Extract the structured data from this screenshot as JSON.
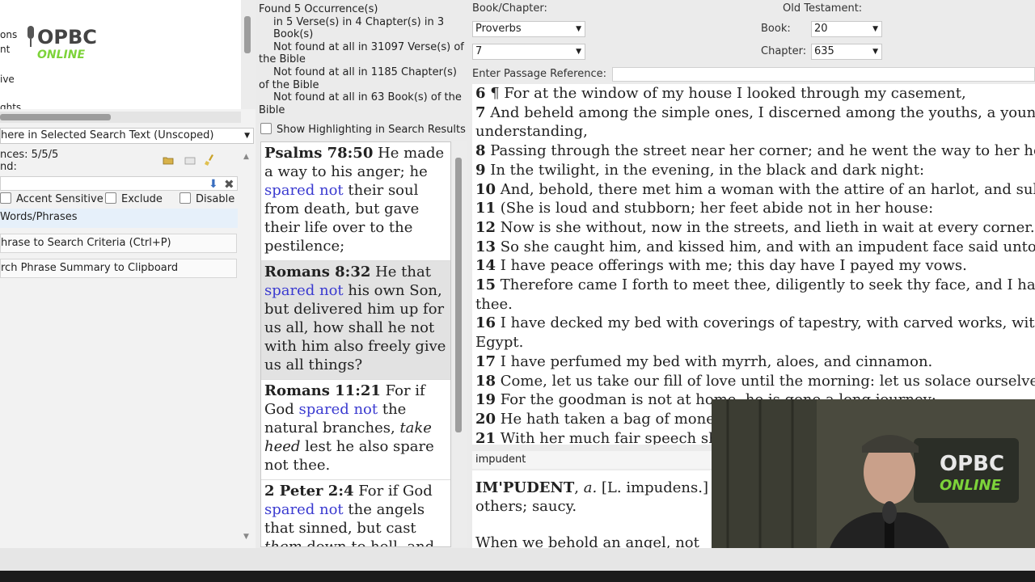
{
  "left_panel": {
    "nav_items": [
      "ons",
      "nt",
      "ive",
      "ghts"
    ],
    "logo_text": "OPBC",
    "logo_subtext": "ONLINE",
    "scope_select_value": "here in Selected Search Text (Unscoped)",
    "matches_label": "nces: 5/5/5",
    "found_label": "nd:",
    "options": {
      "accent_sensitive": "Accent Sensitive",
      "exclude": "Exclude",
      "disable": "Disable"
    },
    "words_phrases_item": "Words/Phrases",
    "add_phrase_button": "hrase to Search Criteria (Ctrl+P)",
    "copy_summary_button": "rch Phrase Summary to Clipboard"
  },
  "results": {
    "line1": "Found 5 Occurrence(s)",
    "line2": "in 5 Verse(s) in 4 Chapter(s) in 3 Book(s)",
    "line3": "Not found at all in 31097 Verse(s) of the Bible",
    "line4": "Not found at all in 1185 Chapter(s) of the Bible",
    "line5": "Not found at all in 63 Book(s) of the Bible",
    "show_highlighting": "Show Highlighting in Search Results",
    "items": [
      {
        "ref": "Psalms 78:50",
        "pre": " He made a way to his anger; he ",
        "hl": "spared not",
        "post": " their soul from death, but gave their life over to the pestilence;",
        "italic": ""
      },
      {
        "ref": "Romans 8:32",
        "pre": " He that ",
        "hl": "spared not",
        "post": " his own Son, but delivered him up for us all, how shall he not with him also freely give us all things?",
        "italic": ""
      },
      {
        "ref": "Romans 11:21",
        "pre": " For if God ",
        "hl": "spared not",
        "post": " the natural branches, ",
        "italic": "take heed",
        "post2": " lest he also spare not thee."
      },
      {
        "ref": "2 Peter 2:4",
        "pre": " For if God ",
        "hl": "spared not",
        "post": " the angels that sinned, but cast ",
        "italic": "them",
        "post2": " down to hell, and"
      }
    ]
  },
  "passage": {
    "book_chapter_label": "Book/Chapter:",
    "book_value": "Proverbs",
    "chapter_value": "7",
    "testament_label": "Old Testament:",
    "book_num_label": "Book:",
    "book_num_value": "20",
    "chapter_num_label": "Chapter:",
    "chapter_num_value": "635",
    "enter_ref_label": "Enter Passage Reference:"
  },
  "verses": [
    {
      "n": "6",
      "t": " ¶ For at the window of my house I looked through my casement,"
    },
    {
      "n": "7",
      "t": " And beheld among the simple ones, I discerned among the youths, a young man void of"
    },
    {
      "n": "",
      "t": "understanding,"
    },
    {
      "n": "8",
      "t": " Passing through the street near her corner; and he went the way to her house,"
    },
    {
      "n": "9",
      "t": " In the twilight, in the evening, in the black and dark night:"
    },
    {
      "n": "10",
      "t": " And, behold, there met him a woman with the attire of an harlot, and subtil of heart."
    },
    {
      "n": "11",
      "t": " (She is loud and stubborn; her feet abide not in her house:"
    },
    {
      "n": "12",
      "t": " Now is she without, now in the streets, and lieth in wait at every corner.)"
    },
    {
      "n": "13",
      "t": " So she caught him, and kissed him, and with an impudent face said unto him,"
    },
    {
      "n": "14",
      "t": " I have peace offerings with me; this day have I payed my vows."
    },
    {
      "n": "15",
      "t": " Therefore came I forth to meet thee, diligently to seek thy face, and I have found"
    },
    {
      "n": "",
      "t": "thee."
    },
    {
      "n": "16",
      "t": " I have decked my bed with coverings of tapestry, with carved works, with fine linen of"
    },
    {
      "n": "",
      "t": "Egypt."
    },
    {
      "n": "17",
      "t": " I have perfumed my bed with myrrh, aloes, and cinnamon."
    },
    {
      "n": "18",
      "t": " Come, let us take our fill of love until the morning: let us solace ourselves with loves."
    },
    {
      "n": "19",
      "t": " For the goodman is not at home, he is gone a long journey:"
    },
    {
      "n": "20",
      "t": " He hath taken a bag of money with him, and will come home at the day appointed."
    },
    {
      "n": "21",
      "t": " With her much fair speech she caused him to yield,"
    }
  ],
  "dictionary": {
    "search_word": "impudent",
    "headword": "IM'PUDENT",
    "pos": "a.",
    "etym": " [L. impudens.]",
    "def_line2": "others; saucy.",
    "example": "When we behold an angel, not to"
  },
  "webcam": {
    "sign_text": "OPBC",
    "sign_subtext": "ONLINE"
  },
  "colors": {
    "highlight": "#3a3ad0",
    "selected_row": "#e2e2e2",
    "logo_green": "#7dd33a"
  }
}
